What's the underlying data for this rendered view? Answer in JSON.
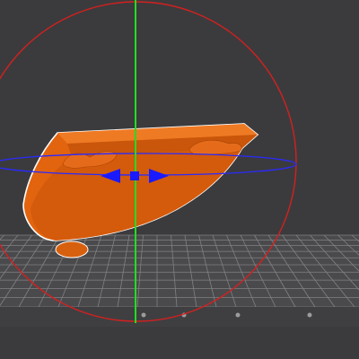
{
  "viewport": {
    "background": "#3b3b3d",
    "bed_color": "#4a4a4c",
    "grid_color": "#8a8a8d",
    "model_color": "#e2640f",
    "model_shade": "#b84a09",
    "outline_color": "#ffffff"
  },
  "gizmo": {
    "mode": "rotate",
    "rings": [
      {
        "axis": "z",
        "color": "#d42020"
      },
      {
        "axis": "y",
        "color": "#2a2aff"
      },
      {
        "axis": "x",
        "color": "#22dd22"
      }
    ],
    "handle_color": "#1a1aff"
  },
  "model": {
    "name": "",
    "selected": true
  }
}
